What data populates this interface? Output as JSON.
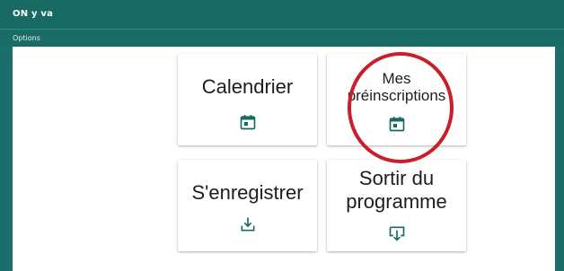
{
  "app": {
    "title": "ON y va"
  },
  "menu": {
    "options_label": "Options"
  },
  "cards": [
    {
      "label": "Calendrier",
      "icon": "calendar-icon"
    },
    {
      "label_line1": "Mes",
      "label_line2": "préinscriptions",
      "icon": "calendar-icon"
    },
    {
      "label": "S'enregistrer",
      "icon": "download-icon"
    },
    {
      "label_line1": "Sortir du",
      "label_line2": "programme",
      "icon": "exit-download-icon"
    }
  ],
  "colors": {
    "header": "#176964",
    "accent": "#1c6e6a",
    "highlight_ring": "#c91f2a"
  }
}
